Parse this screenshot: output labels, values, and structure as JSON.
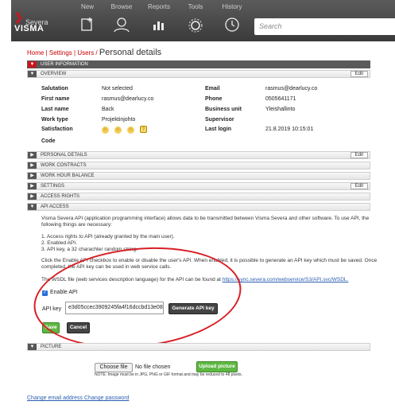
{
  "nav": {
    "logo_text": "VISMA",
    "logo_sub": "Severa",
    "items": [
      {
        "label": "New",
        "icon": "new-document-icon"
      },
      {
        "label": "Browse",
        "icon": "browse-user-icon"
      },
      {
        "label": "Reports",
        "icon": "reports-chart-icon"
      },
      {
        "label": "Tools",
        "icon": "tools-gear-icon"
      },
      {
        "label": "History",
        "icon": "history-clock-icon"
      }
    ],
    "search_placeholder": "Search"
  },
  "breadcrumb": {
    "home": "Home",
    "settings": "Settings",
    "users": "Users",
    "page_title": "Personal details"
  },
  "sections": {
    "user_information": "USER INFORMATION",
    "overview": "OVERVIEW",
    "personal_details": "PERSONAL DETAILS",
    "work_contracts": "WORK CONTRACTS",
    "work_hour_balance": "WORK HOUR BALANCE",
    "settings": "SETTINGS",
    "access_rights": "ACCESS RIGHTS",
    "api_access": "API ACCESS",
    "picture": "PICTURE",
    "edit_label": "Edit"
  },
  "overview": {
    "salutation_label": "Salutation",
    "salutation_value": "Not selected",
    "first_name_label": "First name",
    "first_name_value": "rasmus@dearlucy.co",
    "last_name_label": "Last name",
    "last_name_value": "Back",
    "work_type_label": "Work type",
    "work_type_value": "Projektinjohto",
    "satisfaction_label": "Satisfaction",
    "code_label": "Code",
    "email_label": "Email",
    "email_value": "rasmus@dearlucy.co",
    "phone_label": "Phone",
    "phone_value": "0505641171",
    "business_unit_label": "Business unit",
    "business_unit_value": "Yleishallinto",
    "supervisor_label": "Supervisor",
    "supervisor_value": "",
    "last_login_label": "Last login",
    "last_login_value": "21.8.2019 10:15:01"
  },
  "api": {
    "intro": "Visma Severa API (application programming interface) allows data to be transmitted between Visma Severa and other software. To use API, the following things are necessary:",
    "req1": "1. Access rights to API (already granted by the main user).",
    "req2": "2. Enabled API.",
    "req3": "3. API key, a 32 charachter random string.",
    "enable_info": "Click the Enable API checkbox to enable or disable the user's API. When enabled, it is possible to generate an API key which must be saved. Once completed, the API key can be used in web service calls.",
    "wsdl_text": "The WSDL file (web services description language) for the API can be found at",
    "wsdl_link": "https://sync.severa.com/webservice/S3/API.svc/WSDL.",
    "enable_label": "Enable API",
    "key_label": "API key",
    "key_value": "e3d05ccec3909245fa4f16dccbd13e08",
    "generate_label": "Generate API key",
    "save_label": "Save",
    "cancel_label": "Cancel"
  },
  "picture": {
    "choose_file_label": "Choose file",
    "file_status": "No file chosen",
    "upload_label": "Upload picture",
    "note": "NOTE: Image must be in JPG, PNG or GIF format and may be reduced to 48 pixels."
  },
  "footer": {
    "change_email": "Change email address",
    "change_password": "Change password"
  },
  "colors": {
    "nav_bg": "#4a4a4a",
    "accent_red": "#c8161d",
    "button_green": "#5fb744",
    "link_blue": "#2a5db0"
  }
}
